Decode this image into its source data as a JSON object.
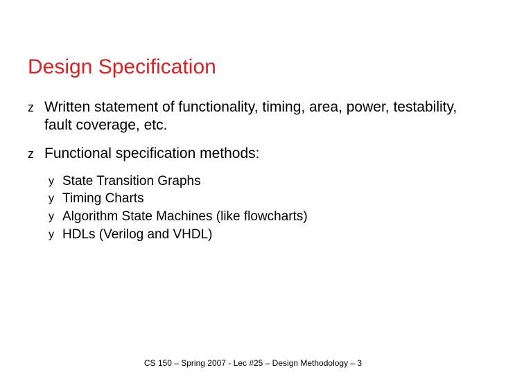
{
  "title": "Design Specification",
  "bullets": [
    {
      "marker": "z",
      "text": "Written statement of functionality, timing, area, power, testability, fault coverage, etc."
    },
    {
      "marker": "z",
      "text": "Functional specification methods:",
      "sub": [
        {
          "marker": "y",
          "text": "State Transition Graphs"
        },
        {
          "marker": "y",
          "text": "Timing Charts"
        },
        {
          "marker": "y",
          "text": "Algorithm State Machines (like flowcharts)"
        },
        {
          "marker": "y",
          "text": "HDLs (Verilog and VHDL)"
        }
      ]
    }
  ],
  "footer": "CS 150 – Spring  2007 - Lec #25 – Design Methodology  – 3"
}
